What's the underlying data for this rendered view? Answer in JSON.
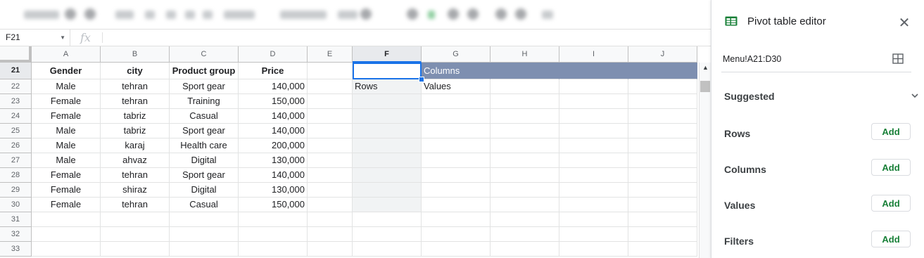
{
  "formula_bar": {
    "cell_ref": "F21",
    "fx_symbol": "fx",
    "formula": ""
  },
  "columns": [
    "A",
    "B",
    "C",
    "D",
    "E",
    "F",
    "G",
    "H",
    "I",
    "J"
  ],
  "rows": [
    "21",
    "22",
    "23",
    "24",
    "25",
    "26",
    "27",
    "28",
    "29",
    "30",
    "31",
    "32",
    "33"
  ],
  "table": {
    "headers": [
      "Gender",
      "city",
      "Product group",
      "Price"
    ],
    "rows": [
      [
        "Male",
        "tehran",
        "Sport gear",
        "140,000"
      ],
      [
        "Female",
        "tehran",
        "Training",
        "150,000"
      ],
      [
        "Female",
        "tabriz",
        "Casual",
        "140,000"
      ],
      [
        "Male",
        "tabriz",
        "Sport gear",
        "140,000"
      ],
      [
        "Male",
        "karaj",
        "Health care",
        "200,000"
      ],
      [
        "Male",
        "ahvaz",
        "Digital",
        "130,000"
      ],
      [
        "Female",
        "tehran",
        "Sport gear",
        "140,000"
      ],
      [
        "Female",
        "shiraz",
        "Digital",
        "130,000"
      ],
      [
        "Female",
        "tehran",
        "Casual",
        "150,000"
      ]
    ]
  },
  "pivot": {
    "columns_label": "Columns",
    "rows_label": "Rows",
    "values_label": "Values"
  },
  "selected": {
    "column": "F",
    "row": "21"
  },
  "panel": {
    "title": "Pivot table editor",
    "range": "Menu!A21:D30",
    "suggested_label": "Suggested",
    "sections": [
      {
        "label": "Rows",
        "button": "Add"
      },
      {
        "label": "Columns",
        "button": "Add"
      },
      {
        "label": "Values",
        "button": "Add"
      },
      {
        "label": "Filters",
        "button": "Add"
      }
    ]
  },
  "colors": {
    "pivot_header": "#7e8fb0",
    "selection": "#1a73e8",
    "add_button_text": "#188038",
    "sheets_icon": "#188038"
  },
  "icons": {
    "toolbar": "blurred-toolbar-icons",
    "panel": "sheets-icon",
    "close": "close-icon",
    "range": "grid-select-icon",
    "suggested": "chevron-down-icon"
  }
}
